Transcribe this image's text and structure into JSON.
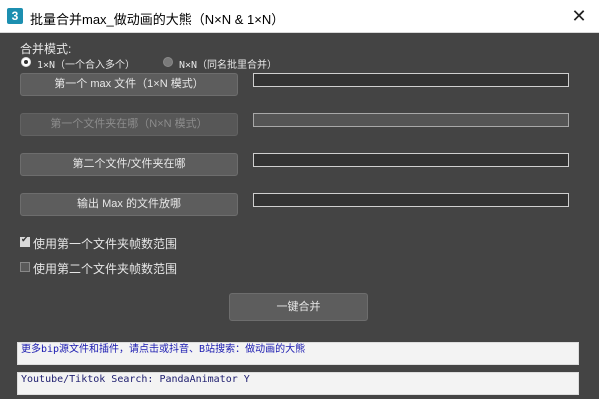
{
  "window": {
    "app_icon_text": "3",
    "title": "批量合并max_做动画的大熊（N×N & 1×N）",
    "close_glyph": "✕"
  },
  "mode": {
    "label": "合并模式:",
    "options": [
      {
        "label": "1×N（一个合入多个）",
        "selected": true
      },
      {
        "label": "N×N（同名批里合并）",
        "selected": false
      }
    ]
  },
  "rows": [
    {
      "button": "第一个 max 文件（1×N 模式）",
      "enabled": true,
      "value": ""
    },
    {
      "button": "第一个文件夹在哪（N×N 模式）",
      "enabled": false,
      "value": ""
    },
    {
      "button": "第二个文件/文件夹在哪",
      "enabled": true,
      "value": ""
    },
    {
      "button": "输出 Max 的文件放哪",
      "enabled": true,
      "value": ""
    }
  ],
  "checkboxes": [
    {
      "label": "使用第一个文件夹帧数范围",
      "checked": true
    },
    {
      "label": "使用第二个文件夹帧数范围",
      "checked": false
    }
  ],
  "merge_button": "一键合并",
  "info": [
    "更多bip源文件和插件，请点击或抖音、B站搜索：做动画的大熊",
    "Youtube/Tiktok Search: PandaAnimator Y"
  ],
  "colors": {
    "background": "#444444",
    "button": "#5d5d5d",
    "link_text": "#1a1ab0"
  }
}
